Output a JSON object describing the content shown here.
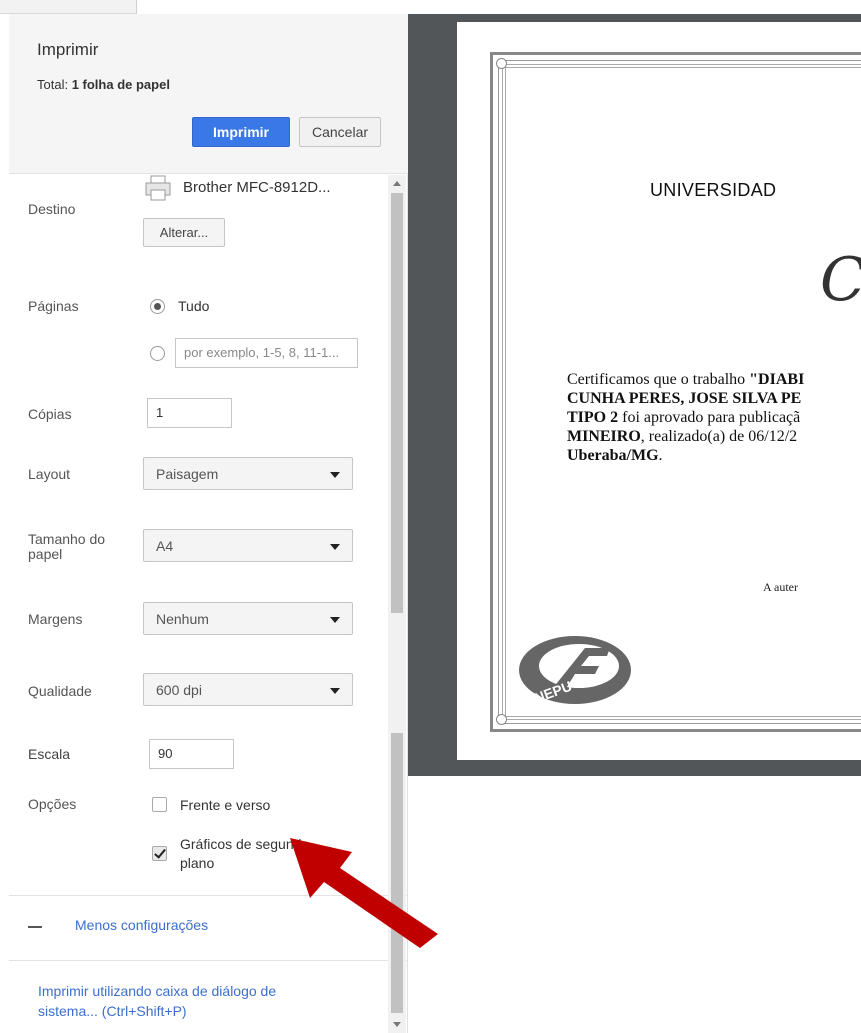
{
  "print_dialog": {
    "title": "Imprimir",
    "total_prefix": "Total: ",
    "total_value": "1 folha de papel",
    "print_button": "Imprimir",
    "cancel_button": "Cancelar"
  },
  "settings": {
    "destination": {
      "label": "Destino",
      "printer_name": "Brother MFC-8912D...",
      "change_button": "Alterar..."
    },
    "pages": {
      "label": "Páginas",
      "all_option": "Tudo",
      "all_selected": true,
      "custom_placeholder": "por exemplo, 1-5, 8, 11-1..."
    },
    "copies": {
      "label": "Cópias",
      "value": "1"
    },
    "layout": {
      "label": "Layout",
      "value": "Paisagem"
    },
    "paper_size": {
      "label_line1": "Tamanho do",
      "label_line2": "papel",
      "value": "A4"
    },
    "margins": {
      "label": "Margens",
      "value": "Nenhum"
    },
    "quality": {
      "label": "Qualidade",
      "value": "600 dpi"
    },
    "scale": {
      "label": "Escala",
      "value": "90"
    },
    "options": {
      "label": "Opções",
      "duplex_label": "Frente e verso",
      "duplex_checked": false,
      "background_label_line1": "Gráficos de segundo",
      "background_label_line2": "plano",
      "background_checked": true
    },
    "less_settings": "Menos configurações",
    "system_dialog_line1": "Imprimir utilizando caixa de diálogo de",
    "system_dialog_line2": "sistema... (Ctrl+Shift+P)"
  },
  "preview": {
    "university": "UNIVERSIDAD",
    "script_letter": "C",
    "body_lines": [
      {
        "normal": "Certificamos que o trabalho ",
        "bold": "\"DIABI"
      },
      {
        "normal": "",
        "bold": "CUNHA PERES, JOSE SILVA PE"
      },
      {
        "normal_after": " foi aprovado para publicaçã",
        "bold": "TIPO 2"
      },
      {
        "normal_after": ", realizado(a) de 06/12/2",
        "bold": "MINEIRO"
      },
      {
        "normal_after": ".",
        "bold": "Uberaba/MG"
      }
    ],
    "authentication": "A auter",
    "logo_text": "UNEPU"
  },
  "colors": {
    "print_button": "#3b78e7",
    "preview_background": "#525659",
    "arrow": "#c00000",
    "link": "#3b6fd0"
  }
}
